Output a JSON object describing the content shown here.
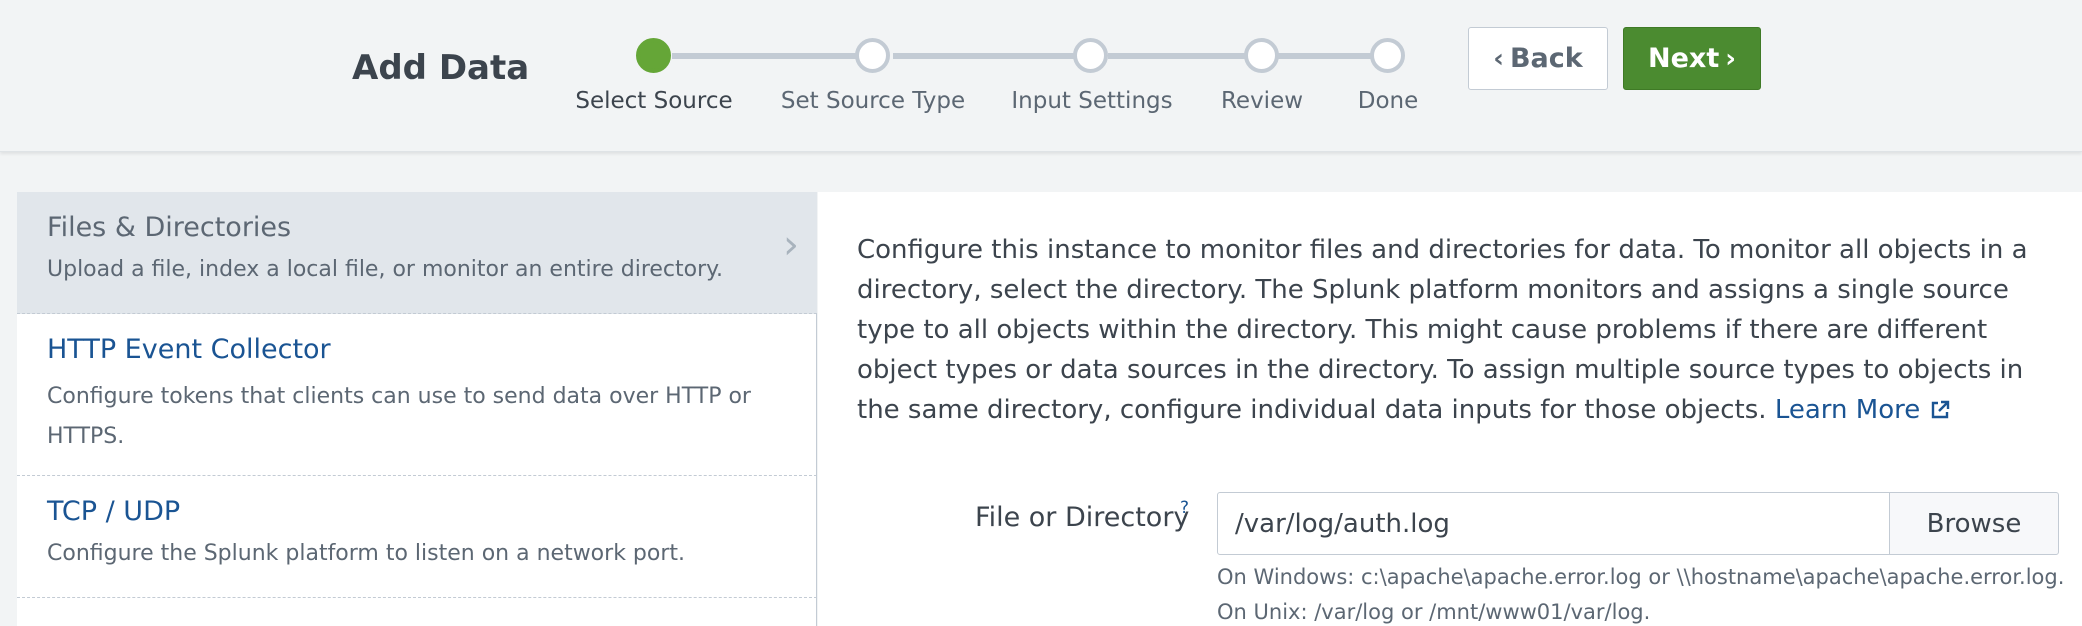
{
  "header": {
    "title": "Add Data",
    "steps": [
      {
        "label": "Select Source",
        "state": "active"
      },
      {
        "label": "Set Source Type",
        "state": "pending"
      },
      {
        "label": "Input Settings",
        "state": "pending"
      },
      {
        "label": "Review",
        "state": "pending"
      },
      {
        "label": "Done",
        "state": "pending"
      }
    ],
    "back_label": "Back",
    "next_label": "Next",
    "colors": {
      "active_step": "#65a637",
      "next_button": "#4b8b30",
      "link": "#1a5493"
    }
  },
  "sources": [
    {
      "title": "Files & Directories",
      "desc": "Upload a file, index a local file, or monitor an entire directory.",
      "selected": true
    },
    {
      "title": "HTTP Event Collector",
      "desc": "Configure tokens that clients can use to send data over HTTP or HTTPS.",
      "selected": false
    },
    {
      "title": "TCP / UDP",
      "desc": "Configure the Splunk platform to listen on a network port.",
      "selected": false
    }
  ],
  "panel": {
    "description": "Configure this instance to monitor files and directories for data. To monitor all objects in a directory, select the directory. The Splunk platform monitors and assigns a single source type to all objects within the directory. This might cause problems if there are different object types or data sources in the directory. To assign multiple source types to objects in the same directory, configure individual data inputs for those objects.",
    "learn_more": "Learn More",
    "field_label": "File or Directory",
    "help_mark": "?",
    "field_value": "/var/log/auth.log",
    "browse_label": "Browse",
    "hint": "On Windows: c:\\apache\\apache.error.log or \\\\hostname\\apache\\apache.error.log. On Unix: /var/log or /mnt/www01/var/log."
  }
}
